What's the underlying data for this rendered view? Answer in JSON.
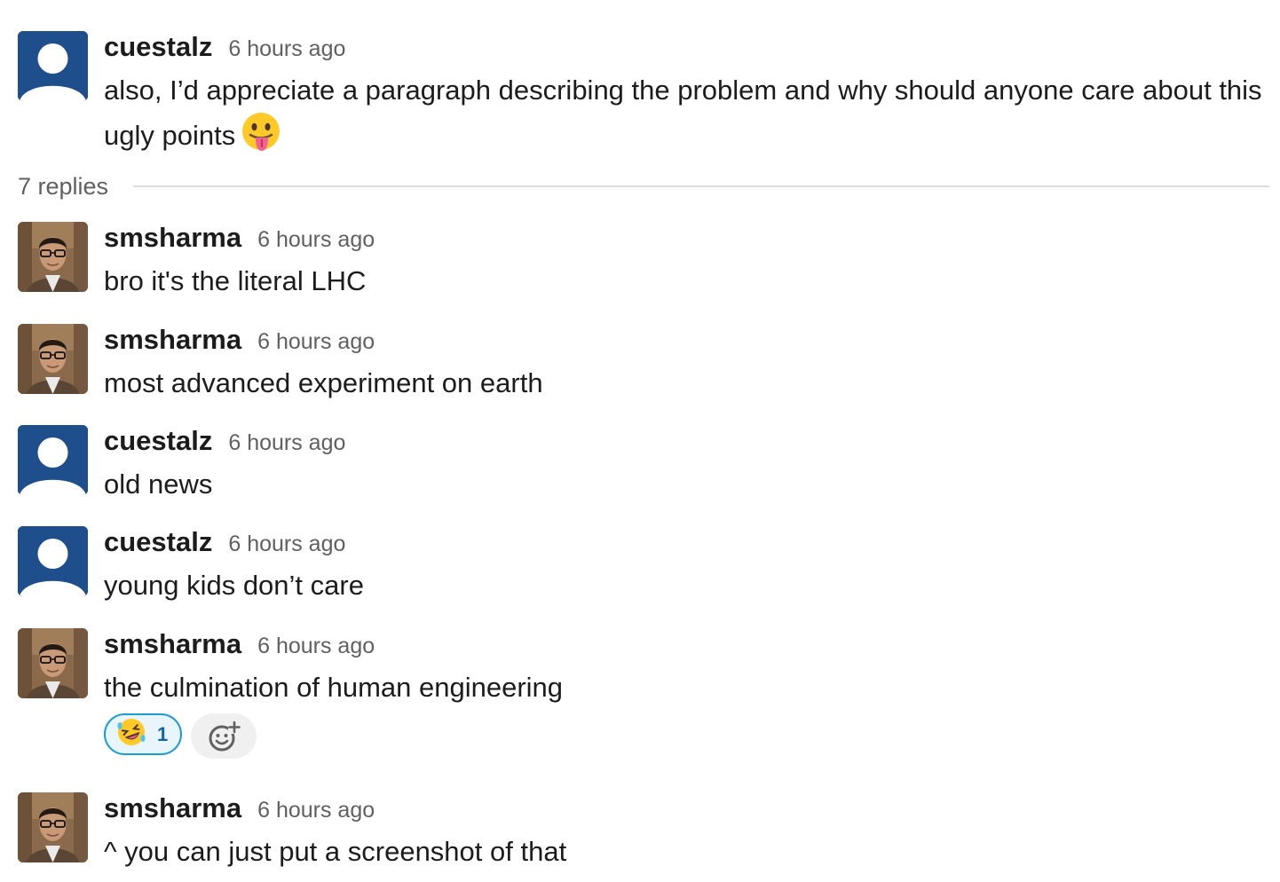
{
  "parent_message": {
    "author": "cuestalz",
    "time": "6 hours ago",
    "text": "also, I’d appreciate a paragraph describing the problem and why should anyone care about this ugly points",
    "emoji": "face-with-tongue-emoji"
  },
  "replies_label": "7 replies",
  "replies": [
    {
      "author": "smsharma",
      "time": "6 hours ago",
      "text": "bro it's the literal LHC"
    },
    {
      "author": "smsharma",
      "time": "6 hours ago",
      "text": "most advanced experiment on earth"
    },
    {
      "author": "cuestalz",
      "time": "6 hours ago",
      "text": "old news"
    },
    {
      "author": "cuestalz",
      "time": "6 hours ago",
      "text": "young kids don’t care"
    },
    {
      "author": "smsharma",
      "time": "6 hours ago",
      "text": "the culmination of human engineering",
      "reaction": {
        "emoji": "rolling-on-floor-laughing-emoji",
        "count": "1"
      }
    },
    {
      "author": "smsharma",
      "time": "6 hours ago",
      "text": "^ you can just put a screenshot of that"
    }
  ],
  "colors": {
    "default_avatar": "#1f4e8c",
    "reaction_border": "#1d9bd1",
    "reaction_bg": "#e8f5fa",
    "timestamp": "#616061"
  }
}
